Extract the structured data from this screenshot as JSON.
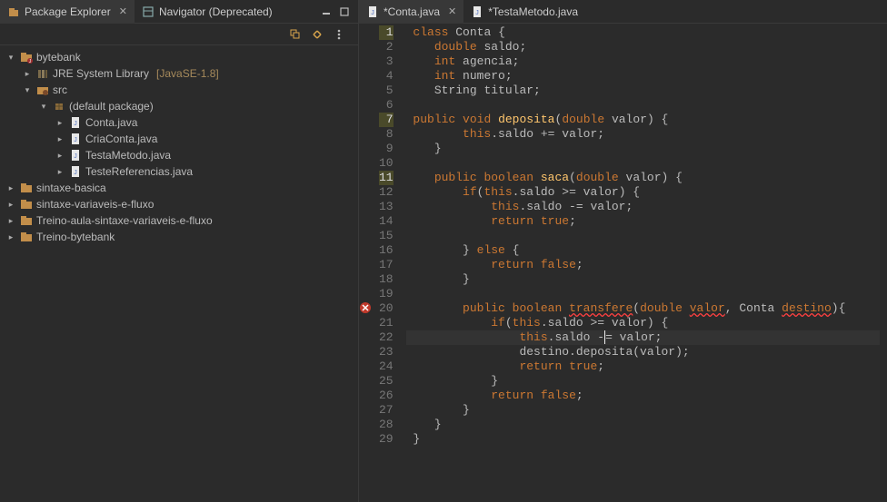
{
  "left_tabs": [
    {
      "label": "Package Explorer",
      "icon": "package-explorer-icon",
      "active": true,
      "closable": true
    },
    {
      "label": "Navigator (Deprecated)",
      "icon": "navigator-icon",
      "active": false,
      "closable": false
    }
  ],
  "minmax_icons": [
    "minimize-icon",
    "maximize-icon"
  ],
  "sub_toolbar_icons": [
    "collapse-all-icon",
    "link-editor-icon",
    "view-menu-icon"
  ],
  "tree": {
    "p0": {
      "label": "bytebank",
      "indent": 0,
      "arrow": "▾",
      "icon": "project"
    },
    "p1": {
      "label": "JRE System Library",
      "deco": "[JavaSE-1.8]",
      "indent": 1,
      "arrow": "▸",
      "icon": "library"
    },
    "p2": {
      "label": "src",
      "indent": 1,
      "arrow": "▾",
      "icon": "src"
    },
    "p3": {
      "label": "(default package)",
      "indent": 2,
      "arrow": "▾",
      "icon": "package"
    },
    "p4": {
      "label": "Conta.java",
      "indent": 3,
      "arrow": "▸",
      "icon": "java"
    },
    "p5": {
      "label": "CriaConta.java",
      "indent": 3,
      "arrow": "▸",
      "icon": "java"
    },
    "p6": {
      "label": "TestaMetodo.java",
      "indent": 3,
      "arrow": "▸",
      "icon": "java"
    },
    "p7": {
      "label": "TesteReferencias.java",
      "indent": 3,
      "arrow": "▸",
      "icon": "java"
    },
    "p8": {
      "label": "sintaxe-basica",
      "indent": 0,
      "arrow": "▸",
      "icon": "project"
    },
    "p9": {
      "label": "sintaxe-variaveis-e-fluxo",
      "indent": 0,
      "arrow": "▸",
      "icon": "project"
    },
    "p10": {
      "label": "Treino-aula-sintaxe-variaveis-e-fluxo",
      "indent": 0,
      "arrow": "▸",
      "icon": "project"
    },
    "p11": {
      "label": "Treino-bytebank",
      "indent": 0,
      "arrow": "▸",
      "icon": "project"
    }
  },
  "editor_tabs": [
    {
      "label": "*Conta.java",
      "icon": "java-icon",
      "active": true
    },
    {
      "label": "*TestaMetodo.java",
      "icon": "java-icon",
      "active": false
    }
  ],
  "code": {
    "lines": 29,
    "highlight_lines": [
      1,
      7,
      11
    ],
    "error_line": 20,
    "dot_line": 11,
    "current_line": 22,
    "tokens": {
      "class": "class",
      "double": "double",
      "int": "int",
      "String": "String",
      "public": "public",
      "void": "void",
      "boolean": "boolean",
      "if": "if",
      "this": "this",
      "return": "return",
      "true": "true",
      "false": "false",
      "else": "else",
      "Conta": "Conta",
      "saldo": "saldo",
      "agencia": "agencia",
      "numero": "numero",
      "titular": "titular",
      "deposita": "deposita",
      "saca": "saca",
      "transfere": "transfere",
      "valor": "valor",
      "destino": "destino"
    },
    "l1": " class Conta {",
    "l22_op": "-="
  }
}
